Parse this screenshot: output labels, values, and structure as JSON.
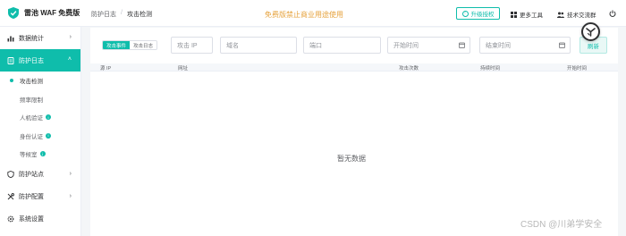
{
  "brand": {
    "name": "雷池 WAF 免费版"
  },
  "breadcrumb": {
    "parent": "防护日志",
    "separator": "/",
    "current": "攻击检测"
  },
  "notice": "免费版禁止商业用途使用",
  "header": {
    "upgrade_label": "升级授权",
    "tools_label": "更多工具",
    "community_label": "技术交流群"
  },
  "sidebar": {
    "items": [
      {
        "label": "数据统计"
      },
      {
        "label": "防护日志"
      },
      {
        "label": "防护站点"
      },
      {
        "label": "防护配置"
      },
      {
        "label": "系统设置"
      }
    ],
    "sub_items": [
      {
        "label": "攻击检测"
      },
      {
        "label": "频率限制"
      },
      {
        "label": "人机验证"
      },
      {
        "label": "身份认证"
      },
      {
        "label": "等候室"
      }
    ]
  },
  "filters": {
    "seg_attack": "攻击事件",
    "seg_log": "攻击日志",
    "ip_placeholder": "攻击 IP",
    "domain_placeholder": "域名",
    "port_placeholder": "端口",
    "start_placeholder": "开始时间",
    "end_placeholder": "结束时间",
    "refresh_label": "刷新"
  },
  "table": {
    "columns": [
      "源 IP",
      "网址",
      "攻击次数",
      "持续时间",
      "开始时间"
    ],
    "empty_text": "暂无数据"
  },
  "watermark": "CSDN @川弟学安全",
  "colors": {
    "accent": "#0fbdab",
    "warning": "#e6a23c"
  }
}
